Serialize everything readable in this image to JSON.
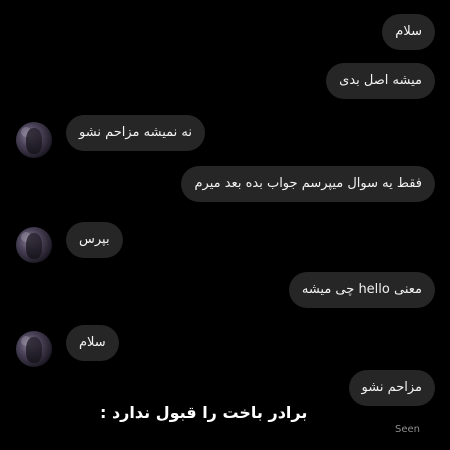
{
  "messages": [
    {
      "side": "sent",
      "text": "سلام"
    },
    {
      "side": "sent",
      "text": "میشه اصل بدی"
    },
    {
      "side": "received",
      "text": "نه نمیشه مزاحم نشو"
    },
    {
      "side": "sent",
      "text": "فقط یه سوال میپرسم جواب بده بعد میرم"
    },
    {
      "side": "received",
      "text": "بپرس"
    },
    {
      "side": "sent",
      "text": "معنی hello چی میشه"
    },
    {
      "side": "received",
      "text": "سلام"
    },
    {
      "side": "sent",
      "text": "مزاحم نشو"
    }
  ],
  "status": {
    "seen": "Seen"
  },
  "caption": "برادر باخت را قبول ندارد :",
  "colors": {
    "background": "#000000",
    "bubble": "#262626",
    "text": "#f2f2f2",
    "seen": "#8e8e8e"
  }
}
